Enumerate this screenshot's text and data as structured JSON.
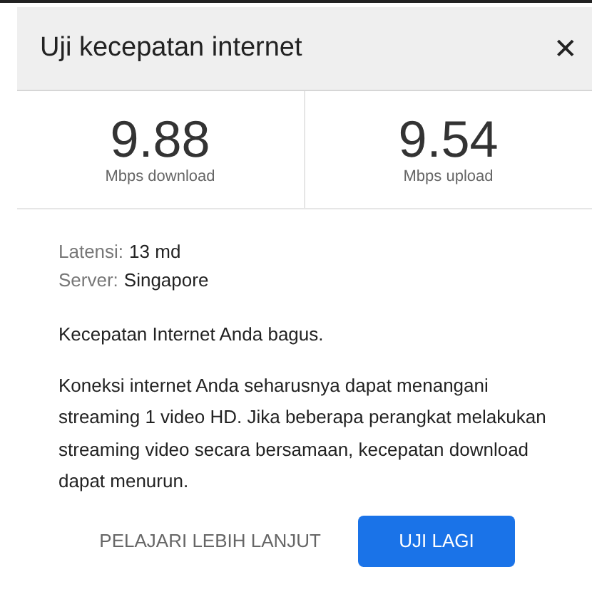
{
  "dialog": {
    "title": "Uji kecepatan internet",
    "close": "✕"
  },
  "stats": [
    {
      "value": "9.88",
      "unit": "Mbps download"
    },
    {
      "value": "9.54",
      "unit": "Mbps upload"
    }
  ],
  "details": [
    {
      "label": "Latensi:",
      "value": "13 md"
    },
    {
      "label": "Server:",
      "value": "Singapore"
    }
  ],
  "summary": "Kecepatan Internet Anda bagus.",
  "description": "Koneksi internet Anda seharusnya dapat menangani streaming 1 video HD. Jika beberapa perangkat melakukan streaming video secara bersamaan, kecepatan download dapat menurun.",
  "buttons": [
    {
      "label": "PELAJARI LEBIH LANJUT",
      "kind": "text"
    },
    {
      "label": "UJI LAGI",
      "kind": "primary"
    }
  ]
}
